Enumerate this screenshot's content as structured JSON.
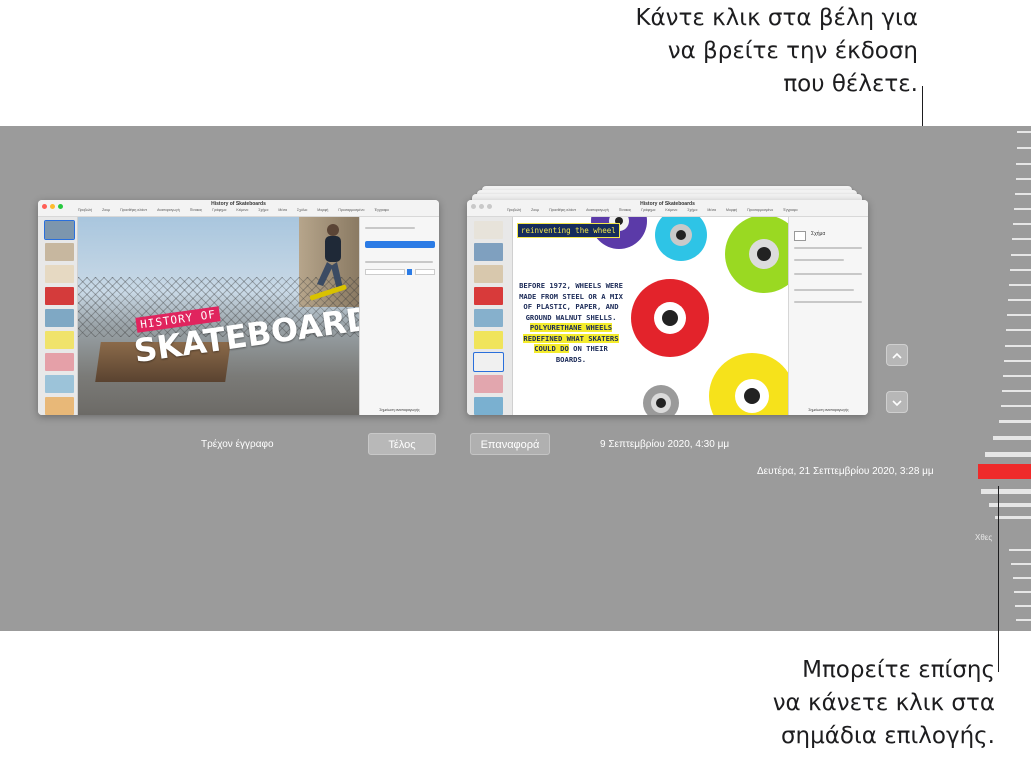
{
  "callouts": {
    "top_lines": [
      "Κάντε κλικ στα βέλη για",
      "να βρείτε την έκδοση",
      "που θέλετε."
    ],
    "bottom_lines": [
      "Μπορείτε επίσης",
      "να κάνετε κλικ στα",
      "σημάδια επιλογής."
    ]
  },
  "current_window": {
    "title": "History of Skateboards",
    "toolbar": [
      "Προβολή",
      "Ζουμ",
      "Προσθήκη σλάιντ",
      "Αναπαραγωγή",
      "Πίνακας",
      "Γράφημα",
      "Κείμενο",
      "Σχήμα",
      "Μέσα",
      "Σχόλιο",
      "Μορφή",
      "Προσαρμοσμένο",
      "Έγγραφο"
    ],
    "slide_tag": "HISTORY OF",
    "slide_title": "SKATEBOARDS",
    "footer": "Σημείωση αναπαραγωγής"
  },
  "old_window": {
    "title": "History of Skateboards",
    "slide_heading": "reinventing the wheel",
    "body_plain_1": "BEFORE 1972, WHEELS WERE MADE FROM STEEL OR A MIX OF PLASTIC, PAPER, AND GROUND WALNUT SHELLS.",
    "body_highlight": "POLYURETHANE WHEELS REDEFINED WHAT SKATERS COULD DO",
    "body_plain_2": "ON THEIR BOARDS.",
    "inspector_label": "Σχήμα",
    "footer": "Σημείωση αναπαραγωγής"
  },
  "labels": {
    "current_document": "Τρέχον έγγραφο",
    "done_button": "Τέλος",
    "restore_button": "Επαναφορά",
    "version_date": "9 Σεπτεμβρίου 2020, 4:30 μμ",
    "timeline_selected": "Δευτέρα, 21 Σεπτεμβρίου 2020, 3:28 μμ",
    "timeline_yesterday": "Χθες"
  },
  "icons": {
    "up": "chevron-up-icon",
    "down": "chevron-down-icon"
  },
  "colors": {
    "panel": "#9b9b9b",
    "selected_tick": "#ef2a2a",
    "highlight": "#f4ec2d"
  }
}
